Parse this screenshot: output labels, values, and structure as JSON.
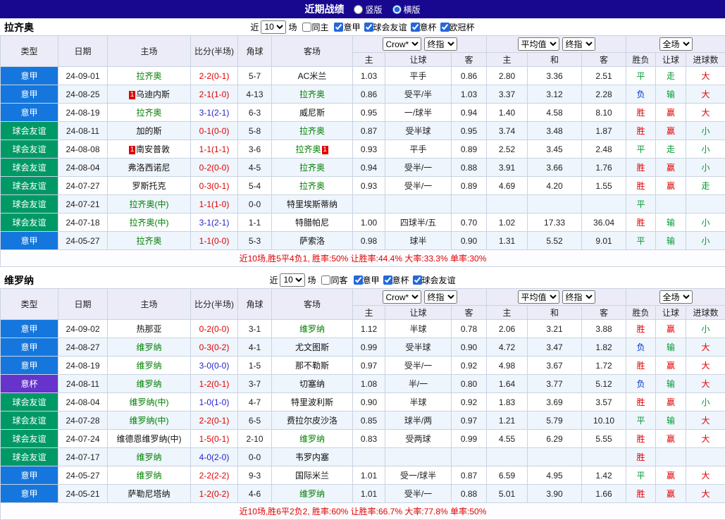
{
  "header": {
    "title": "近期战绩",
    "vertical_label": "竖版",
    "horizontal_label": "横版",
    "selected_layout": "横版"
  },
  "table_headers": {
    "type": "类型",
    "date": "日期",
    "home": "主场",
    "score": "比分(半场)",
    "corner": "角球",
    "away": "客场",
    "odds_sub": [
      "主",
      "让球",
      "客"
    ],
    "avg_sub": [
      "主",
      "和",
      "客"
    ],
    "result_sub": [
      "胜负",
      "让球",
      "进球数"
    ]
  },
  "league_colors": {
    "意甲": "#1577dd",
    "球会友谊": "#009966",
    "意杯": "#6633cc"
  },
  "sections": [
    {
      "team": "拉齐奥",
      "filter": {
        "near": "近",
        "count": "10",
        "unit": "场",
        "same": "同主",
        "same_checked": false,
        "leagues": [
          {
            "label": "意甲",
            "checked": true
          },
          {
            "label": "球会友谊",
            "checked": true
          },
          {
            "label": "意杯",
            "checked": true
          },
          {
            "label": "欧冠杯",
            "checked": true
          }
        ]
      },
      "controls": {
        "odds_source": "Crow*",
        "odds_period": "终指",
        "avg": "平均值",
        "avg_period": "终指",
        "scope": "全场"
      },
      "rows": [
        {
          "type": "意甲",
          "date": "24-09-01",
          "home": {
            "name": "拉齐奥",
            "focal": true
          },
          "score": "2-2(0-1)",
          "score_color": "red",
          "corner": "5-7",
          "away": {
            "name": "AC米兰"
          },
          "odds": [
            "1.03",
            "平手",
            "0.86"
          ],
          "avg": [
            "2.80",
            "3.36",
            "2.51"
          ],
          "res": [
            [
              "平",
              "green"
            ],
            [
              "走",
              "green"
            ],
            [
              "大",
              "red"
            ]
          ]
        },
        {
          "type": "意甲",
          "date": "24-08-25",
          "home": {
            "name": "乌迪内斯",
            "card": "1"
          },
          "score": "2-1(1-0)",
          "score_color": "red",
          "corner": "4-13",
          "away": {
            "name": "拉齐奥",
            "focal": true
          },
          "odds": [
            "0.86",
            "受平/半",
            "1.03"
          ],
          "avg": [
            "3.37",
            "3.12",
            "2.28"
          ],
          "res": [
            [
              "负",
              "blue"
            ],
            [
              "输",
              "green"
            ],
            [
              "大",
              "red"
            ]
          ]
        },
        {
          "type": "意甲",
          "date": "24-08-19",
          "home": {
            "name": "拉齐奥",
            "focal": true
          },
          "score": "3-1(2-1)",
          "score_color": "blue",
          "corner": "6-3",
          "away": {
            "name": "威尼斯"
          },
          "odds": [
            "0.95",
            "一/球半",
            "0.94"
          ],
          "avg": [
            "1.40",
            "4.58",
            "8.10"
          ],
          "res": [
            [
              "胜",
              "red"
            ],
            [
              "赢",
              "red"
            ],
            [
              "大",
              "red"
            ]
          ]
        },
        {
          "type": "球会友谊",
          "date": "24-08-11",
          "home": {
            "name": "加的斯"
          },
          "score": "0-1(0-0)",
          "score_color": "red",
          "corner": "5-8",
          "away": {
            "name": "拉齐奥",
            "focal": true
          },
          "odds": [
            "0.87",
            "受半球",
            "0.95"
          ],
          "avg": [
            "3.74",
            "3.48",
            "1.87"
          ],
          "res": [
            [
              "胜",
              "red"
            ],
            [
              "赢",
              "red"
            ],
            [
              "小",
              "green"
            ]
          ]
        },
        {
          "type": "球会友谊",
          "date": "24-08-08",
          "home": {
            "name": "南安普敦",
            "card": "1"
          },
          "score": "1-1(1-1)",
          "score_color": "red",
          "corner": "3-6",
          "away": {
            "name": "拉齐奥",
            "focal": true,
            "card": "1"
          },
          "odds": [
            "0.93",
            "平手",
            "0.89"
          ],
          "avg": [
            "2.52",
            "3.45",
            "2.48"
          ],
          "res": [
            [
              "平",
              "green"
            ],
            [
              "走",
              "green"
            ],
            [
              "小",
              "green"
            ]
          ]
        },
        {
          "type": "球会友谊",
          "date": "24-08-04",
          "home": {
            "name": "弗洛西诺尼"
          },
          "score": "0-2(0-0)",
          "score_color": "red",
          "corner": "4-5",
          "away": {
            "name": "拉齐奥",
            "focal": true
          },
          "odds": [
            "0.94",
            "受半/一",
            "0.88"
          ],
          "avg": [
            "3.91",
            "3.66",
            "1.76"
          ],
          "res": [
            [
              "胜",
              "red"
            ],
            [
              "赢",
              "red"
            ],
            [
              "小",
              "green"
            ]
          ]
        },
        {
          "type": "球会友谊",
          "date": "24-07-27",
          "home": {
            "name": "罗斯托克"
          },
          "score": "0-3(0-1)",
          "score_color": "red",
          "corner": "5-4",
          "away": {
            "name": "拉齐奥",
            "focal": true
          },
          "odds": [
            "0.93",
            "受半/一",
            "0.89"
          ],
          "avg": [
            "4.69",
            "4.20",
            "1.55"
          ],
          "res": [
            [
              "胜",
              "red"
            ],
            [
              "赢",
              "red"
            ],
            [
              "走",
              "green"
            ]
          ]
        },
        {
          "type": "球会友谊",
          "date": "24-07-21",
          "home": {
            "name": "拉齐奥(中)",
            "focal": true
          },
          "score": "1-1(1-0)",
          "score_color": "red",
          "corner": "0-0",
          "away": {
            "name": "特里埃斯蒂纳"
          },
          "odds": [
            "",
            "",
            ""
          ],
          "avg": [
            "",
            "",
            ""
          ],
          "res": [
            [
              "平",
              "green"
            ],
            [
              "",
              ""
            ],
            [
              "",
              ""
            ]
          ]
        },
        {
          "type": "球会友谊",
          "date": "24-07-18",
          "home": {
            "name": "拉齐奥(中)",
            "focal": true
          },
          "score": "3-1(2-1)",
          "score_color": "blue",
          "corner": "1-1",
          "away": {
            "name": "特腊帕尼"
          },
          "odds": [
            "1.00",
            "四球半/五",
            "0.70"
          ],
          "avg": [
            "1.02",
            "17.33",
            "36.04"
          ],
          "res": [
            [
              "胜",
              "red"
            ],
            [
              "输",
              "green"
            ],
            [
              "小",
              "green"
            ]
          ]
        },
        {
          "type": "意甲",
          "date": "24-05-27",
          "home": {
            "name": "拉齐奥",
            "focal": true
          },
          "score": "1-1(0-0)",
          "score_color": "red",
          "corner": "5-3",
          "away": {
            "name": "萨索洛"
          },
          "odds": [
            "0.98",
            "球半",
            "0.90"
          ],
          "avg": [
            "1.31",
            "5.52",
            "9.01"
          ],
          "res": [
            [
              "平",
              "green"
            ],
            [
              "输",
              "green"
            ],
            [
              "小",
              "green"
            ]
          ]
        }
      ],
      "summary": "近10场,胜5平4负1, 胜率:50% 让胜率:44.4% 大率:33.3% 单率:30%"
    },
    {
      "team": "维罗纳",
      "filter": {
        "near": "近",
        "count": "10",
        "unit": "场",
        "same": "同客",
        "same_checked": false,
        "leagues": [
          {
            "label": "意甲",
            "checked": true
          },
          {
            "label": "意杯",
            "checked": true
          },
          {
            "label": "球会友谊",
            "checked": true
          }
        ]
      },
      "controls": {
        "odds_source": "Crow*",
        "odds_period": "终指",
        "avg": "平均值",
        "avg_period": "终指",
        "scope": "全场"
      },
      "rows": [
        {
          "type": "意甲",
          "date": "24-09-02",
          "home": {
            "name": "热那亚"
          },
          "score": "0-2(0-0)",
          "score_color": "red",
          "corner": "3-1",
          "away": {
            "name": "维罗纳",
            "focal": true
          },
          "odds": [
            "1.12",
            "半球",
            "0.78"
          ],
          "avg": [
            "2.06",
            "3.21",
            "3.88"
          ],
          "res": [
            [
              "胜",
              "red"
            ],
            [
              "赢",
              "red"
            ],
            [
              "小",
              "green"
            ]
          ]
        },
        {
          "type": "意甲",
          "date": "24-08-27",
          "home": {
            "name": "维罗纳",
            "focal": true
          },
          "score": "0-3(0-2)",
          "score_color": "red",
          "corner": "4-1",
          "away": {
            "name": "尤文图斯"
          },
          "odds": [
            "0.99",
            "受半球",
            "0.90"
          ],
          "avg": [
            "4.72",
            "3.47",
            "1.82"
          ],
          "res": [
            [
              "负",
              "blue"
            ],
            [
              "输",
              "green"
            ],
            [
              "大",
              "red"
            ]
          ]
        },
        {
          "type": "意甲",
          "date": "24-08-19",
          "home": {
            "name": "维罗纳",
            "focal": true
          },
          "score": "3-0(0-0)",
          "score_color": "blue",
          "corner": "1-5",
          "away": {
            "name": "那不勒斯"
          },
          "odds": [
            "0.97",
            "受半/一",
            "0.92"
          ],
          "avg": [
            "4.98",
            "3.67",
            "1.72"
          ],
          "res": [
            [
              "胜",
              "red"
            ],
            [
              "赢",
              "red"
            ],
            [
              "大",
              "red"
            ]
          ]
        },
        {
          "type": "意杯",
          "date": "24-08-11",
          "home": {
            "name": "维罗纳",
            "focal": true
          },
          "score": "1-2(0-1)",
          "score_color": "red",
          "corner": "3-7",
          "away": {
            "name": "切塞纳"
          },
          "odds": [
            "1.08",
            "半/一",
            "0.80"
          ],
          "avg": [
            "1.64",
            "3.77",
            "5.12"
          ],
          "res": [
            [
              "负",
              "blue"
            ],
            [
              "输",
              "green"
            ],
            [
              "大",
              "red"
            ]
          ]
        },
        {
          "type": "球会友谊",
          "date": "24-08-04",
          "home": {
            "name": "维罗纳(中)",
            "focal": true
          },
          "score": "1-0(1-0)",
          "score_color": "blue",
          "corner": "4-7",
          "away": {
            "name": "特里波利斯"
          },
          "odds": [
            "0.90",
            "半球",
            "0.92"
          ],
          "avg": [
            "1.83",
            "3.69",
            "3.57"
          ],
          "res": [
            [
              "胜",
              "red"
            ],
            [
              "赢",
              "red"
            ],
            [
              "小",
              "green"
            ]
          ]
        },
        {
          "type": "球会友谊",
          "date": "24-07-28",
          "home": {
            "name": "维罗纳(中)",
            "focal": true
          },
          "score": "2-2(0-1)",
          "score_color": "red",
          "corner": "6-5",
          "away": {
            "name": "费拉尔皮沙洛"
          },
          "odds": [
            "0.85",
            "球半/两",
            "0.97"
          ],
          "avg": [
            "1.21",
            "5.79",
            "10.10"
          ],
          "res": [
            [
              "平",
              "green"
            ],
            [
              "输",
              "green"
            ],
            [
              "大",
              "red"
            ]
          ]
        },
        {
          "type": "球会友谊",
          "date": "24-07-24",
          "home": {
            "name": "维德恩维罗纳(中)"
          },
          "score": "1-5(0-1)",
          "score_color": "red",
          "corner": "2-10",
          "away": {
            "name": "维罗纳",
            "focal": true
          },
          "odds": [
            "0.83",
            "受两球",
            "0.99"
          ],
          "avg": [
            "4.55",
            "6.29",
            "5.55"
          ],
          "res": [
            [
              "胜",
              "red"
            ],
            [
              "赢",
              "red"
            ],
            [
              "大",
              "red"
            ]
          ]
        },
        {
          "type": "球会友谊",
          "date": "24-07-17",
          "home": {
            "name": "维罗纳",
            "focal": true
          },
          "score": "4-0(2-0)",
          "score_color": "blue",
          "corner": "0-0",
          "away": {
            "name": "韦罗内塞"
          },
          "odds": [
            "",
            "",
            ""
          ],
          "avg": [
            "",
            "",
            ""
          ],
          "res": [
            [
              "胜",
              "red"
            ],
            [
              "",
              ""
            ],
            [
              "",
              ""
            ]
          ]
        },
        {
          "type": "意甲",
          "date": "24-05-27",
          "home": {
            "name": "维罗纳",
            "focal": true
          },
          "score": "2-2(2-2)",
          "score_color": "red",
          "corner": "9-3",
          "away": {
            "name": "国际米兰"
          },
          "odds": [
            "1.01",
            "受一/球半",
            "0.87"
          ],
          "avg": [
            "6.59",
            "4.95",
            "1.42"
          ],
          "res": [
            [
              "平",
              "green"
            ],
            [
              "赢",
              "red"
            ],
            [
              "大",
              "red"
            ]
          ]
        },
        {
          "type": "意甲",
          "date": "24-05-21",
          "home": {
            "name": "萨勒尼塔纳"
          },
          "score": "1-2(0-2)",
          "score_color": "red",
          "corner": "4-6",
          "away": {
            "name": "维罗纳",
            "focal": true
          },
          "odds": [
            "1.01",
            "受半/一",
            "0.88"
          ],
          "avg": [
            "5.01",
            "3.90",
            "1.66"
          ],
          "res": [
            [
              "胜",
              "red"
            ],
            [
              "赢",
              "red"
            ],
            [
              "大",
              "red"
            ]
          ]
        }
      ],
      "summary": "近10场,胜6平2负2, 胜率:60% 让胜率:66.7% 大率:77.8% 单率:50%"
    }
  ]
}
